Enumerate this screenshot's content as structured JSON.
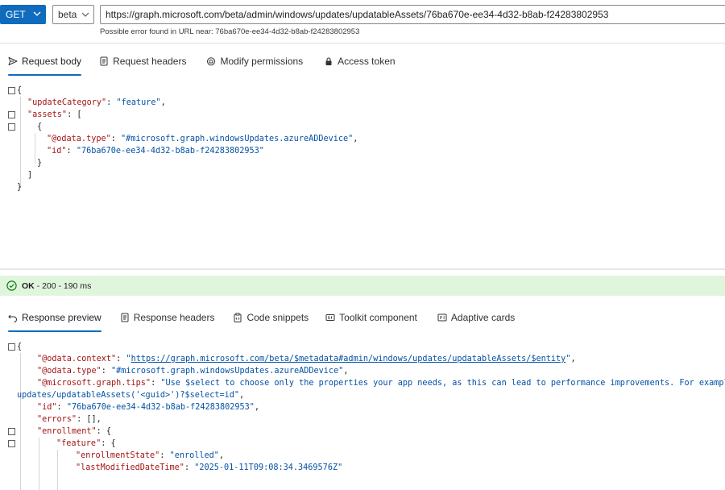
{
  "request": {
    "method": "GET",
    "version": "beta",
    "url": "https://graph.microsoft.com/beta/admin/windows/updates/updatableAssets/76ba670e-ee34-4d32-b8ab-f24283802953",
    "url_hint": "Possible error found in URL near: 76ba670e-ee34-4d32-b8ab-f24283802953"
  },
  "request_tabs": [
    {
      "label": "Request body",
      "icon": "send-icon",
      "active": true
    },
    {
      "label": "Request headers",
      "icon": "document-icon",
      "active": false
    },
    {
      "label": "Modify permissions",
      "icon": "shield-icon",
      "active": false
    },
    {
      "label": "Access token",
      "icon": "lock-icon",
      "active": false
    }
  ],
  "request_body": {
    "open_brace": "{",
    "k_updateCategory": "\"updateCategory\"",
    "v_updateCategory": "\"feature\"",
    "k_assets": "\"assets\"",
    "open_arr": "[",
    "open_obj": "{",
    "k_odata_type": "\"@odata.type\"",
    "v_odata_type": "\"#microsoft.graph.windowsUpdates.azureADDevice\"",
    "k_id": "\"id\"",
    "v_id": "\"76ba670e-ee34-4d32-b8ab-f24283802953\"",
    "close_obj": "}",
    "close_arr": "]",
    "close_brace": "}"
  },
  "status": {
    "ok": "OK",
    "detail": "- 200 - 190 ms",
    "color": "#dff6dd"
  },
  "response_tabs": [
    {
      "label": "Response preview",
      "icon": "undo-arrow-icon",
      "active": true
    },
    {
      "label": "Response headers",
      "icon": "document-icon",
      "active": false
    },
    {
      "label": "Code snippets",
      "icon": "clipboard-icon",
      "active": false
    },
    {
      "label": "Toolkit component",
      "icon": "toolkit-icon",
      "active": false
    },
    {
      "label": "Adaptive cards",
      "icon": "card-icon",
      "active": false
    }
  ],
  "response_body": {
    "open_brace": "{",
    "k_context": "\"@odata.context\"",
    "v_context": "https://graph.microsoft.com/beta/$metadata#admin/windows/updates/updatableAssets/$entity",
    "k_type": "\"@odata.type\"",
    "v_type": "\"#microsoft.graph.windowsUpdates.azureADDevice\"",
    "k_tips": "\"@microsoft.graph.tips\"",
    "v_tips": "\"Use $select to choose only the properties your app needs, as this can lead to performance improvements. For example: GET",
    "v_tips_wrap": "updates/updatableAssets('<guid>')?$select=id\"",
    "k_id": "\"id\"",
    "v_id": "\"76ba670e-ee34-4d32-b8ab-f24283802953\"",
    "k_errors": "\"errors\"",
    "v_errors": "[]",
    "k_enrollment": "\"enrollment\"",
    "k_feature": "\"feature\"",
    "k_enrollmentState": "\"enrollmentState\"",
    "v_enrollmentState": "\"enrolled\"",
    "k_lastModified": "\"lastModifiedDateTime\"",
    "v_lastModified": "\"2025-01-11T09:08:34.3469576Z\""
  },
  "colors": {
    "accent": "#0f6cbd",
    "json_key": "#a31515",
    "json_string": "#0451a5"
  }
}
